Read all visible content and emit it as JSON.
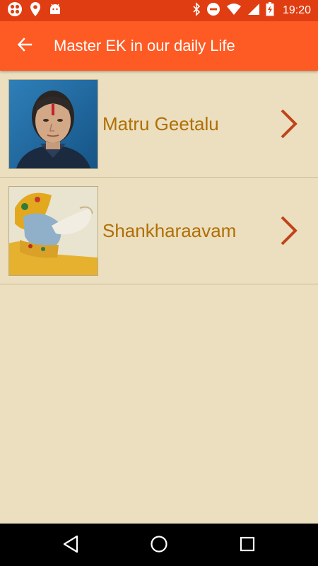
{
  "status_bar": {
    "time": "19:20",
    "left_icons": [
      "app-icon",
      "location-icon",
      "android-icon"
    ],
    "right_icons": [
      "bluetooth-icon",
      "do-not-disturb-icon",
      "wifi-icon",
      "signal-icon",
      "battery-charging-icon"
    ]
  },
  "app_bar": {
    "title": "Master EK in our daily Life",
    "back_icon": "arrow-back-icon"
  },
  "list": {
    "items": [
      {
        "label": "Matru Geetalu",
        "thumbnail": "portrait-photo"
      },
      {
        "label": "Shankharaavam",
        "thumbnail": "krishna-conch-painting"
      }
    ]
  },
  "nav_bar": {
    "icons": [
      "back-triangle-icon",
      "home-circle-icon",
      "recents-square-icon"
    ]
  },
  "colors": {
    "status_bar": "#e03e12",
    "app_bar": "#fe5a24",
    "background": "#ebdfbf",
    "label": "#b06f05",
    "chevron": "#c0441a"
  }
}
